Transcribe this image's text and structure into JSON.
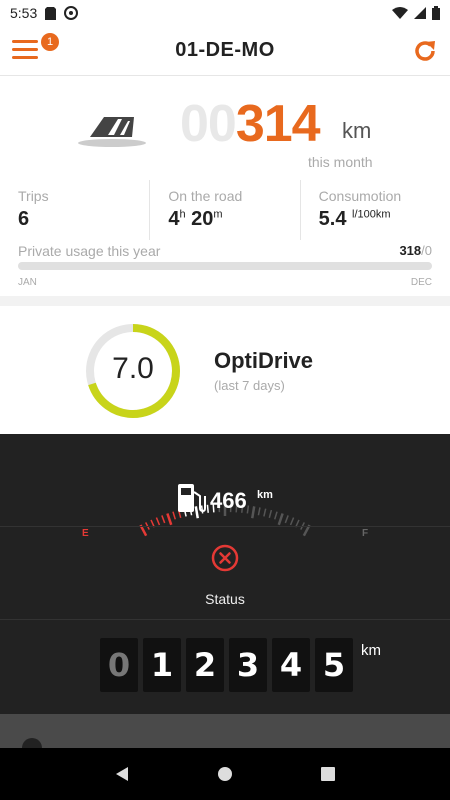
{
  "status_bar": {
    "time": "5:53"
  },
  "app_bar": {
    "title": "01-DE-MO",
    "notification_count": "1",
    "menu_icon": "hamburger-menu-icon",
    "refresh_icon": "refresh-icon"
  },
  "mileage": {
    "zeros": "00",
    "value": "314",
    "unit": "km",
    "period": "this month",
    "car_icon": "car-road-icon"
  },
  "stats": {
    "trips_label": "Trips",
    "trips_value": "6",
    "road_label": "On the road",
    "road_hours": "4",
    "road_h_unit": "h",
    "road_minutes": "20",
    "road_m_unit": "m",
    "consumption_label": "Consumotion",
    "consumption_value": "5.4",
    "consumption_unit": "l/100km"
  },
  "private_usage": {
    "label": "Private usage this year",
    "used": "318",
    "separator_total": "/0",
    "progress": 0,
    "start_label": "JAN",
    "end_label": "DEC"
  },
  "optidrive": {
    "score": "7.0",
    "score_fraction": 0.7,
    "title": "OptiDrive",
    "subtitle": "(last 7 days)"
  },
  "fuel": {
    "value": "466",
    "unit": "km",
    "empty_label": "E",
    "full_label": "F",
    "level": 0.45,
    "icon": "fuel-pump-icon"
  },
  "status": {
    "label": "Status",
    "icon": "error-circle-icon"
  },
  "odometer": {
    "digits": [
      "0",
      "1",
      "2",
      "3",
      "4",
      "5"
    ],
    "unit": "km"
  },
  "colors": {
    "accent": "#e8691e",
    "gauge_green": "#c8d41a",
    "dark_bg": "#222222",
    "status_red": "#e53935"
  }
}
